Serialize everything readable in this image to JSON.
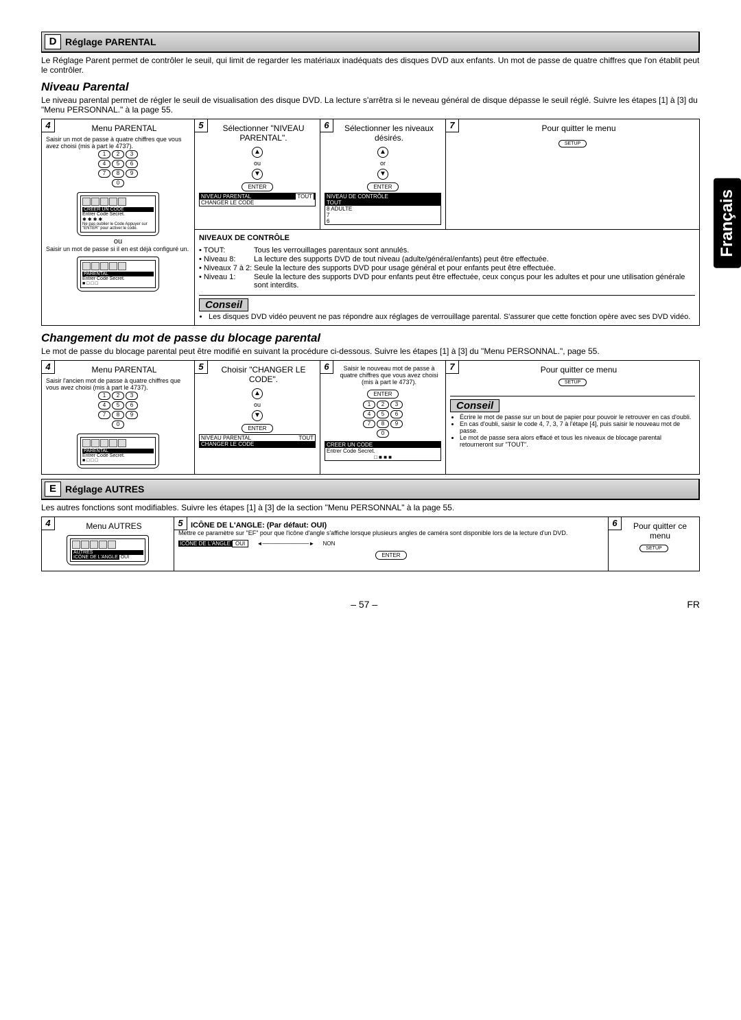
{
  "lang_tab": "Français",
  "sectionD": {
    "letter": "D",
    "title": "Réglage PARENTAL"
  },
  "sectionD_desc": "Le Réglage Parent permet de contrôler le seuil, qui limit de regarder les matériaux inadéquats des disques DVD aux enfants. Un mot de passe de quatre chiffres que l'on établit peut le contrôler.",
  "niveau": {
    "title": "Niveau Parental",
    "desc": "Le niveau parental permet de régler le seuil de visualisation des disque DVD. La lecture s'arrêtra si le neveau général de disque dépasse le seuil réglé. Suivre les étapes [1] à [3] du \"Menu PERSONNAL.\" à la page 55."
  },
  "step4": {
    "num": "4",
    "title": "Menu PARENTAL",
    "desc": "Saisir un mot de passe à quatre chiffres que vous avez choisi (mis à part le 4737).",
    "ou": "ou",
    "tv_header": "CREER UN CODE",
    "tv_line": "Entrer Code Secret.",
    "tv_note": "Ne pas oublier le Code Appuyer sur \"ENTER\" pour activer le code.",
    "ou2": "ou",
    "alt_desc": "Saisir un mot de passe si il en est déjà configuré un.",
    "tv2_cat": "PARENTAL",
    "tv2_line": "Entrer Code Secret."
  },
  "step5": {
    "num": "5",
    "title": "Sélectionner \"NIVEAU PARENTAL\".",
    "menu_sel": "NIVEAU PARENTAL",
    "menu_val": "TOUT",
    "menu_other": "CHANGER LE CODE",
    "ou": "ou"
  },
  "step6": {
    "num": "6",
    "title": "Sélectionner les niveaux désirés.",
    "or": "or",
    "list_header": "NIVEAU DE CONTRÔLE",
    "opts": [
      "TOUT",
      "8 ADULTE",
      "7",
      "6"
    ]
  },
  "step7": {
    "num": "7",
    "title": "Pour quitter le menu",
    "btn": "SETUP"
  },
  "enter": "ENTER",
  "levels": {
    "title": "NIVEAUX DE CONTRÔLE",
    "rows": [
      {
        "l": "• TOUT:",
        "r": "Tous les verrouillages parentaux sont annulés."
      },
      {
        "l": "• Niveau 8:",
        "r": "La lecture des supports DVD de tout niveau (adulte/général/enfants) peut être effectuée."
      },
      {
        "l": "• Niveaux 7 à 2:",
        "r": "Seule la lecture des supports DVD pour usage général et pour enfants peut être effectuée."
      },
      {
        "l": "• Niveau 1:",
        "r": "Seule la lecture des supports DVD pour enfants peut être effectuée, ceux conçus pour les adultes et pour une utilisation générale sont interdits."
      }
    ]
  },
  "conseil1": {
    "title": "Conseil",
    "items": [
      "Les disques DVD vidéo peuvent ne pas répondre aux réglages de verrouillage parental. S'assurer que cette fonction opère avec ses DVD vidéo."
    ]
  },
  "change": {
    "title": "Changement du mot de passe du blocage parental",
    "desc": "Le mot de passe du blocage parental peut être modifié en suivant la procédure ci-dessous. Suivre les étapes [1] à [3] du \"Menu PERSONNAL.\", page 55."
  },
  "cstep4": {
    "num": "4",
    "title": "Menu PARENTAL",
    "desc": "Saisir l'ancien mot de passe à quatre chiffres que vous avez choisi (mis à part le 4737).",
    "tv_cat": "PARENTAL",
    "tv_line": "Entrer Code Secret."
  },
  "cstep5": {
    "num": "5",
    "title": "Choisir \"CHANGER LE CODE\".",
    "menu_other": "NIVEAU PARENTAL",
    "menu_val": "TOUT",
    "menu_sel": "CHANGER LE CODE",
    "ou": "ou"
  },
  "cstep6": {
    "num": "6",
    "title": "Saisir le nouveau mot de passe à quatre chiffres que vous avez choisi (mis à part le 4737).",
    "tv_header": "CREER UN CODE",
    "tv_line": "Entrer Code Secret."
  },
  "cstep7": {
    "num": "7",
    "title": "Pour quitter ce menu",
    "btn": "SETUP"
  },
  "conseil2": {
    "title": "Conseil",
    "items": [
      "Écrire le mot de passe sur un bout de papier pour pouvoir le retrouver en cas d'oubli.",
      "En cas d'oubli, saisir le code 4, 7, 3, 7 à l'étape [4], puis saisir le nouveau mot de passe.",
      "Le mot de passe sera alors effacé et tous les niveaux de blocage parental retourneront sur \"TOUT\"."
    ]
  },
  "sectionE": {
    "letter": "E",
    "title": "Réglage AUTRES",
    "desc": "Les autres fonctions sont modifiables. Suivre les étapes [1] à [3] de la section \"Menu PERSONNAL\" à la page 55."
  },
  "estep4": {
    "num": "4",
    "title": "Menu AUTRES",
    "tv_cat": "AUTRES",
    "tv_row": "ICÔNE DE L'ANGLE",
    "tv_val": "OUI"
  },
  "estep5": {
    "num": "5",
    "title": "ICÔNE DE L'ANGLE: (Par défaut: OUI)",
    "desc": "Mettre ce paramètre sur \"EF\" pour que l'icône d'angle s'affiche lorsque plusieurs angles de caméra sont disponible lors de la lecture d'un DVD.",
    "opt_on": "ICÔNE DE L'ANGLE",
    "val_on": "OUI",
    "val_off": "NON"
  },
  "estep6": {
    "num": "6",
    "title": "Pour quitter ce menu",
    "btn": "SETUP"
  },
  "footer": {
    "page": "– 57 –",
    "lang": "FR"
  }
}
